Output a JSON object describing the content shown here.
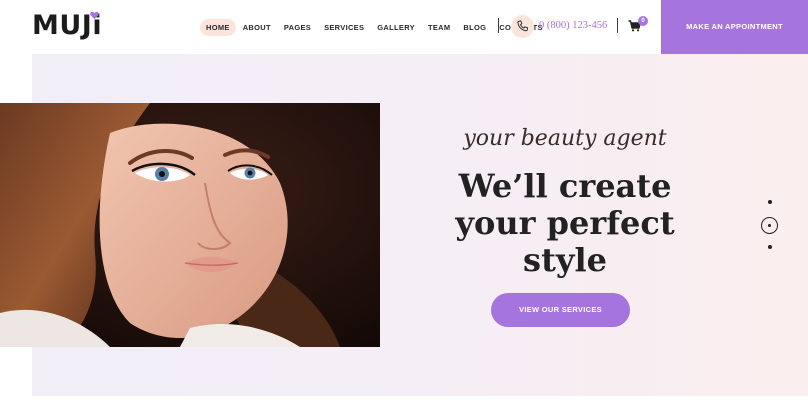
{
  "brand": {
    "name": "MUJi",
    "accent": "#a674de"
  },
  "nav": {
    "items": [
      {
        "label": "HOME",
        "active": true
      },
      {
        "label": "ABOUT"
      },
      {
        "label": "PAGES"
      },
      {
        "label": "SERVICES"
      },
      {
        "label": "GALLERY"
      },
      {
        "label": "TEAM"
      },
      {
        "label": "BLOG"
      },
      {
        "label": "CONTACTS"
      }
    ]
  },
  "contact": {
    "phone": "0 (800) 123-456",
    "icon": "phone-icon"
  },
  "cart": {
    "count": "0",
    "icon": "cart-icon"
  },
  "appointment": {
    "label": "MAKE AN APPOINTMENT"
  },
  "hero": {
    "script": "your beauty agent",
    "headline_line1": "We’ll create",
    "headline_line2": "your perfect",
    "headline_line3": "style",
    "cta_label": "VIEW OUR SERVICES",
    "slider": {
      "total": 3,
      "active": 2
    }
  },
  "colors": {
    "accent": "#a674de",
    "nav_active_bg": "#fbe4dc",
    "phone_text": "#a571d6"
  }
}
